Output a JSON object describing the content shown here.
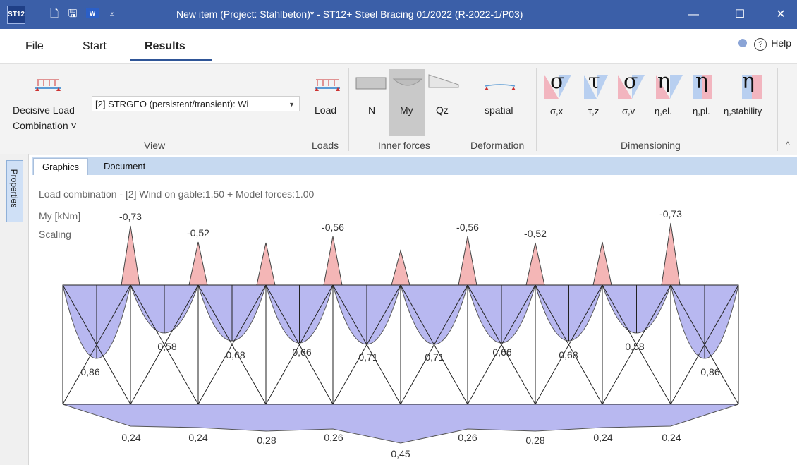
{
  "titlebar": {
    "app_icon": "ST12",
    "title": "New item (Project: Stahlbeton)* - ST12+ Steel Bracing 01/2022 (R-2022-1/P03)",
    "quick_access": [
      "new-file-icon",
      "save-icon",
      "word-icon",
      "customize-icon"
    ],
    "word_label": "W",
    "minimize": "—",
    "maximize": "☐",
    "close": "✕"
  },
  "menu": {
    "file": "File",
    "start": "Start",
    "results": "Results",
    "help": "Help"
  },
  "ribbon": {
    "decisive_load_line1": "Decisive Load",
    "decisive_load_line2": "Combination ˅",
    "combo_value": "[2] STRGEO (persistent/transient): Wi",
    "load": "Load",
    "inner_n": "N",
    "inner_my": "My",
    "inner_qz": "Qz",
    "spatial": "spatial",
    "dim_labels": [
      "σ,x",
      "τ,z",
      "σ,v",
      "η,el.",
      "η,pl.",
      "η,stability"
    ],
    "dim_symbols": [
      "σ",
      "τ",
      "σ",
      "η",
      "η",
      "η"
    ],
    "groups": {
      "view": "View",
      "loads": "Loads",
      "inner_forces": "Inner forces",
      "deformation": "Deformation",
      "dimensioning": "Dimensioning"
    }
  },
  "tabs": {
    "graphics": "Graphics",
    "document": "Document",
    "properties": "Properties"
  },
  "canvas": {
    "line1": "Load combination - [2] Wind on gable:1.50 + Model forces:1.00",
    "line2": "My [kNm]",
    "line3": "Scaling"
  },
  "diagram": {
    "top_peaks": [
      "-0,73",
      "-0,52",
      "",
      "-0,56",
      "",
      "-0,56",
      "-0,52",
      "",
      "-0,73"
    ],
    "mid_values": [
      "0,86",
      "0,58",
      "0,68",
      "0,66",
      "0,71",
      "0,71",
      "0,66",
      "0,68",
      "0,58",
      "0,86"
    ],
    "bottom_values": [
      "0,24",
      "0,24",
      "0,28",
      "0,26",
      "0,45",
      "0,26",
      "0,28",
      "0,24",
      "0,24"
    ]
  },
  "colors": {
    "titlebar": "#3b5fa8",
    "positive_fill": "#b8b8f0",
    "negative_fill": "#f4b6b6",
    "tab_strip": "#c6d9f0"
  }
}
